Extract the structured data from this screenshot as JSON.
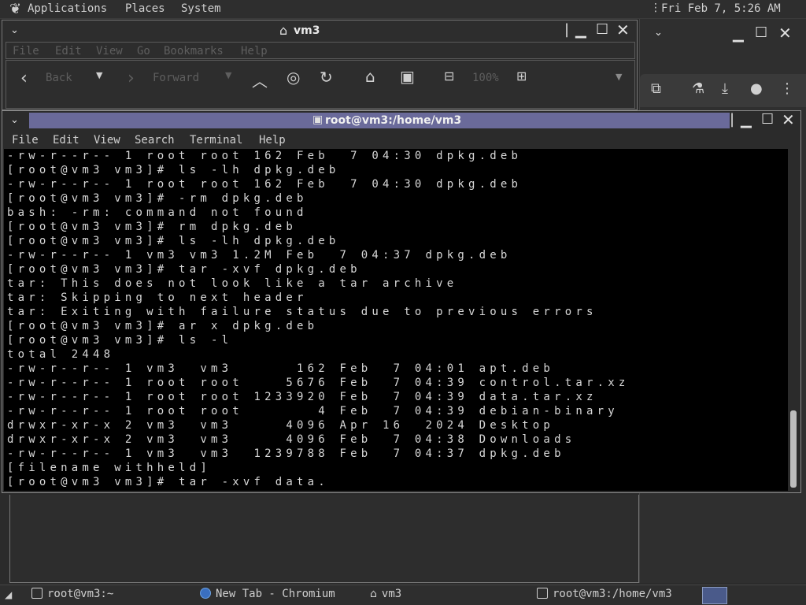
{
  "top_panel": {
    "applications": "Applications",
    "places": "Places",
    "system": "System",
    "clock": "Fri Feb  7,  5:26 AM"
  },
  "file_manager": {
    "title": "vm3",
    "menu": [
      "File",
      "Edit",
      "View",
      "Go",
      "Bookmarks",
      "Help"
    ],
    "back_label": "Back",
    "forward_label": "Forward",
    "zoom": "100%"
  },
  "terminal": {
    "title": "root@vm3:/home/vm3",
    "menu": [
      "File",
      "Edit",
      "View",
      "Search",
      "Terminal",
      "Help"
    ],
    "lines": [
      "-rw-r--r-- 1 root root 162 Feb  7 04:30 dpkg.deb",
      "[root@vm3 vm3]# ls -lh dpkg.deb",
      "-rw-r--r-- 1 root root 162 Feb  7 04:30 dpkg.deb",
      "[root@vm3 vm3]# -rm dpkg.deb",
      "bash: -rm: command not found",
      "[root@vm3 vm3]# rm dpkg.deb",
      "[root@vm3 vm3]# ls -lh dpkg.deb",
      "-rw-r--r-- 1 vm3 vm3 1.2M Feb  7 04:37 dpkg.deb",
      "[root@vm3 vm3]# tar -xvf dpkg.deb",
      "tar: This does not look like a tar archive",
      "tar: Skipping to next header",
      "tar: Exiting with failure status due to previous errors",
      "[root@vm3 vm3]# ar x dpkg.deb",
      "[root@vm3 vm3]# ls -l",
      "total 2448",
      "-rw-r--r-- 1 vm3  vm3      162 Feb  7 04:01 apt.deb",
      "-rw-r--r-- 1 root root    5676 Feb  7 04:39 control.tar.xz",
      "-rw-r--r-- 1 root root 1233920 Feb  7 04:39 data.tar.xz",
      "-rw-r--r-- 1 root root       4 Feb  7 04:39 debian-binary",
      "drwxr-xr-x 2 vm3  vm3     4096 Apr 16  2024 Desktop",
      "drwxr-xr-x 2 vm3  vm3     4096 Feb  7 04:38 Downloads",
      "-rw-r--r-- 1 vm3  vm3  1239788 Feb  7 04:37 dpkg.deb",
      "[filename withheld]",
      "[root@vm3 vm3]# tar -xvf data."
    ]
  },
  "taskbar": {
    "items": [
      "root@vm3:~",
      "New Tab - Chromium",
      "vm3",
      "root@vm3:/home/vm3"
    ]
  }
}
